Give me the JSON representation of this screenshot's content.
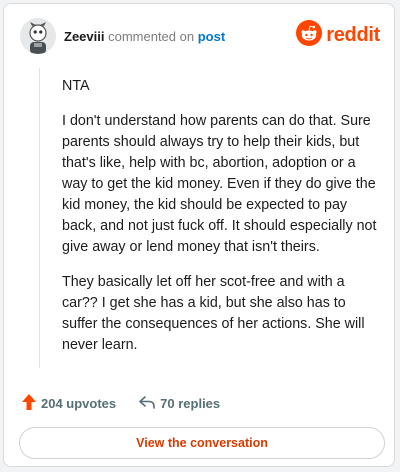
{
  "header": {
    "username": "Zeeviii",
    "commented_on_text": "commented on",
    "post_link": "post",
    "brand": "reddit",
    "brand_color": "#ff4500"
  },
  "comment": {
    "paragraphs": [
      "NTA",
      "I don't understand how parents can do that. Sure parents should always try to help their kids, but that's like, help with bc, abortion, adoption or a way to get the kid money. Even if they do give the kid money, the kid should be expected to pay back, and not just fuck off. It should especially not give away or lend money that isn't theirs.",
      "They basically let off her scot-free and with a car?? I get she has a kid, but she also has to suffer the consequences of her actions. She will never learn."
    ]
  },
  "actions": {
    "upvotes": "204 upvotes",
    "replies": "70 replies"
  },
  "cta": {
    "label": "View the conversation"
  },
  "icons": [
    "avatar",
    "reddit-logo-icon",
    "upvote-icon",
    "reply-icon"
  ]
}
